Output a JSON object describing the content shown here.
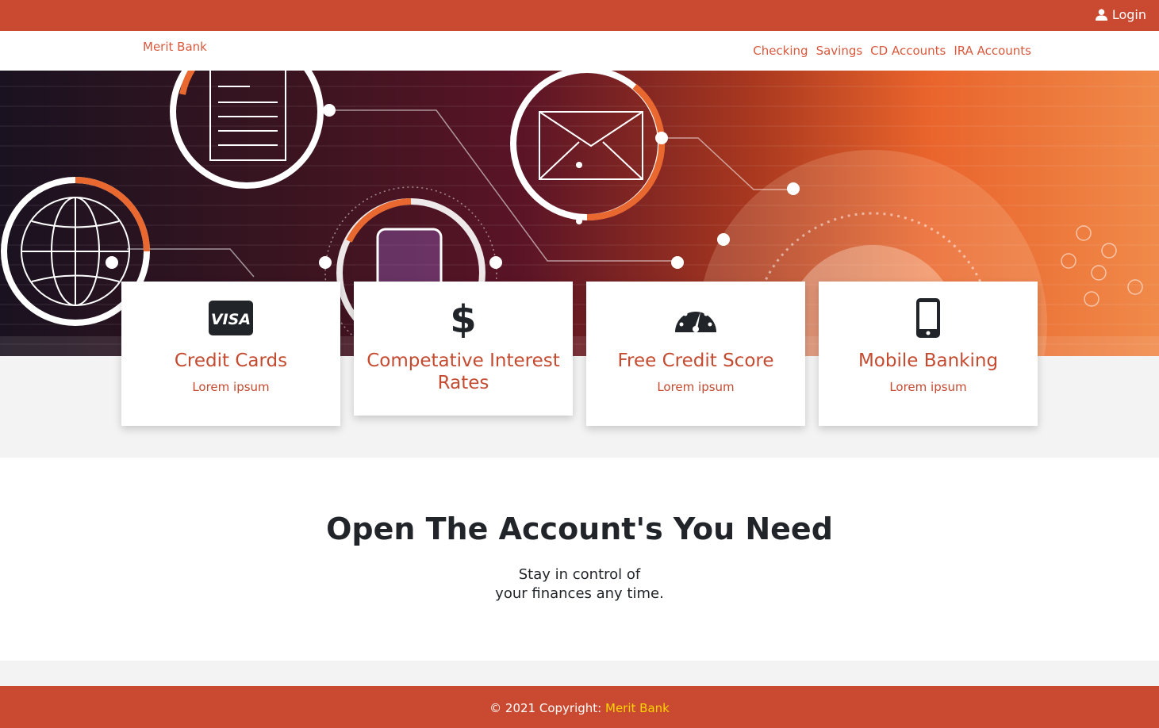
{
  "topbar": {
    "login_label": "Login"
  },
  "navbar": {
    "brand": "Merit Bank",
    "links": [
      "Checking",
      "Savings",
      "CD Accounts",
      "IRA Accounts"
    ]
  },
  "cards": [
    {
      "icon": "visa-icon",
      "title": "Credit Cards",
      "text": "Lorem ipsum"
    },
    {
      "icon": "dollar-icon",
      "title": "Competative Interest Rates",
      "text": ""
    },
    {
      "icon": "speedometer-icon",
      "title": "Free Credit Score",
      "text": "Lorem ipsum"
    },
    {
      "icon": "mobile-phone-icon",
      "title": "Mobile Banking",
      "text": "Lorem ipsum"
    }
  ],
  "section": {
    "heading": "Open The Account's You Need",
    "sub_line1": "Stay in control of",
    "sub_line2": "your finances any time."
  },
  "footer": {
    "copyright": "© 2021 Copyright:",
    "brand": "Merit Bank"
  },
  "colors": {
    "primary": "#c94a31",
    "accent": "#d9593d",
    "footer_link": "#ffd400"
  }
}
